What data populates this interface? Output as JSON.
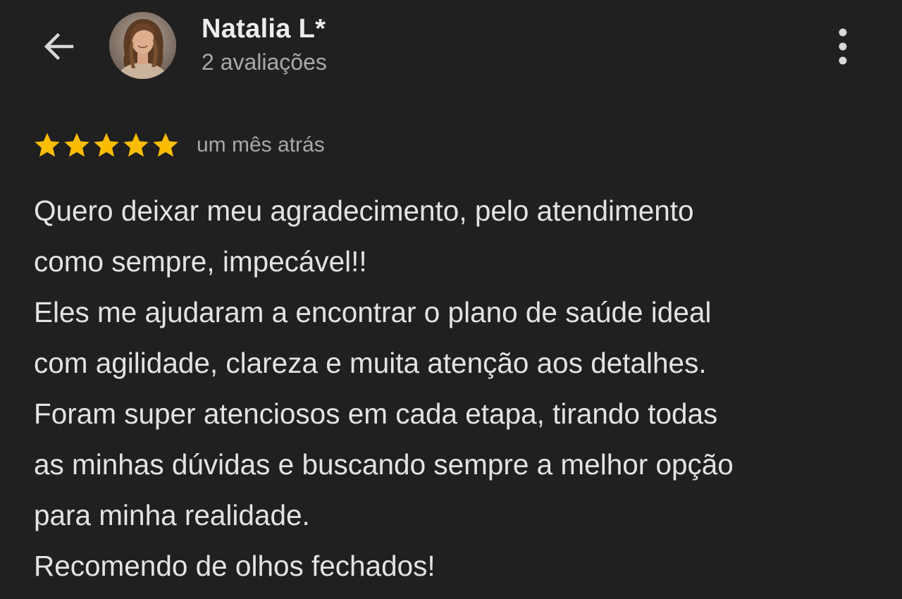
{
  "header": {
    "user_name": "Natalia L*",
    "review_count": "2 avaliações",
    "back_icon": "arrow-left-icon",
    "more_icon": "more-vertical-icon"
  },
  "review": {
    "rating": 5,
    "max_rating": 5,
    "date": "um mês atrás",
    "lines": [
      "Quero deixar meu agradecimento, pelo atendimento",
      "como sempre, impecável!!",
      "Eles me ajudaram a encontrar o plano de saúde ideal",
      "com agilidade, clareza e muita atenção aos detalhes.",
      "Foram super atenciosos em cada etapa, tirando todas",
      "as minhas dúvidas e buscando sempre a melhor opção",
      "para minha realidade.",
      "Recomendo de olhos fechados!"
    ]
  },
  "colors": {
    "background": "#202020",
    "star": "#FBBC04",
    "primary_text": "#E3E3E3",
    "secondary_text": "#A9A9A9"
  }
}
